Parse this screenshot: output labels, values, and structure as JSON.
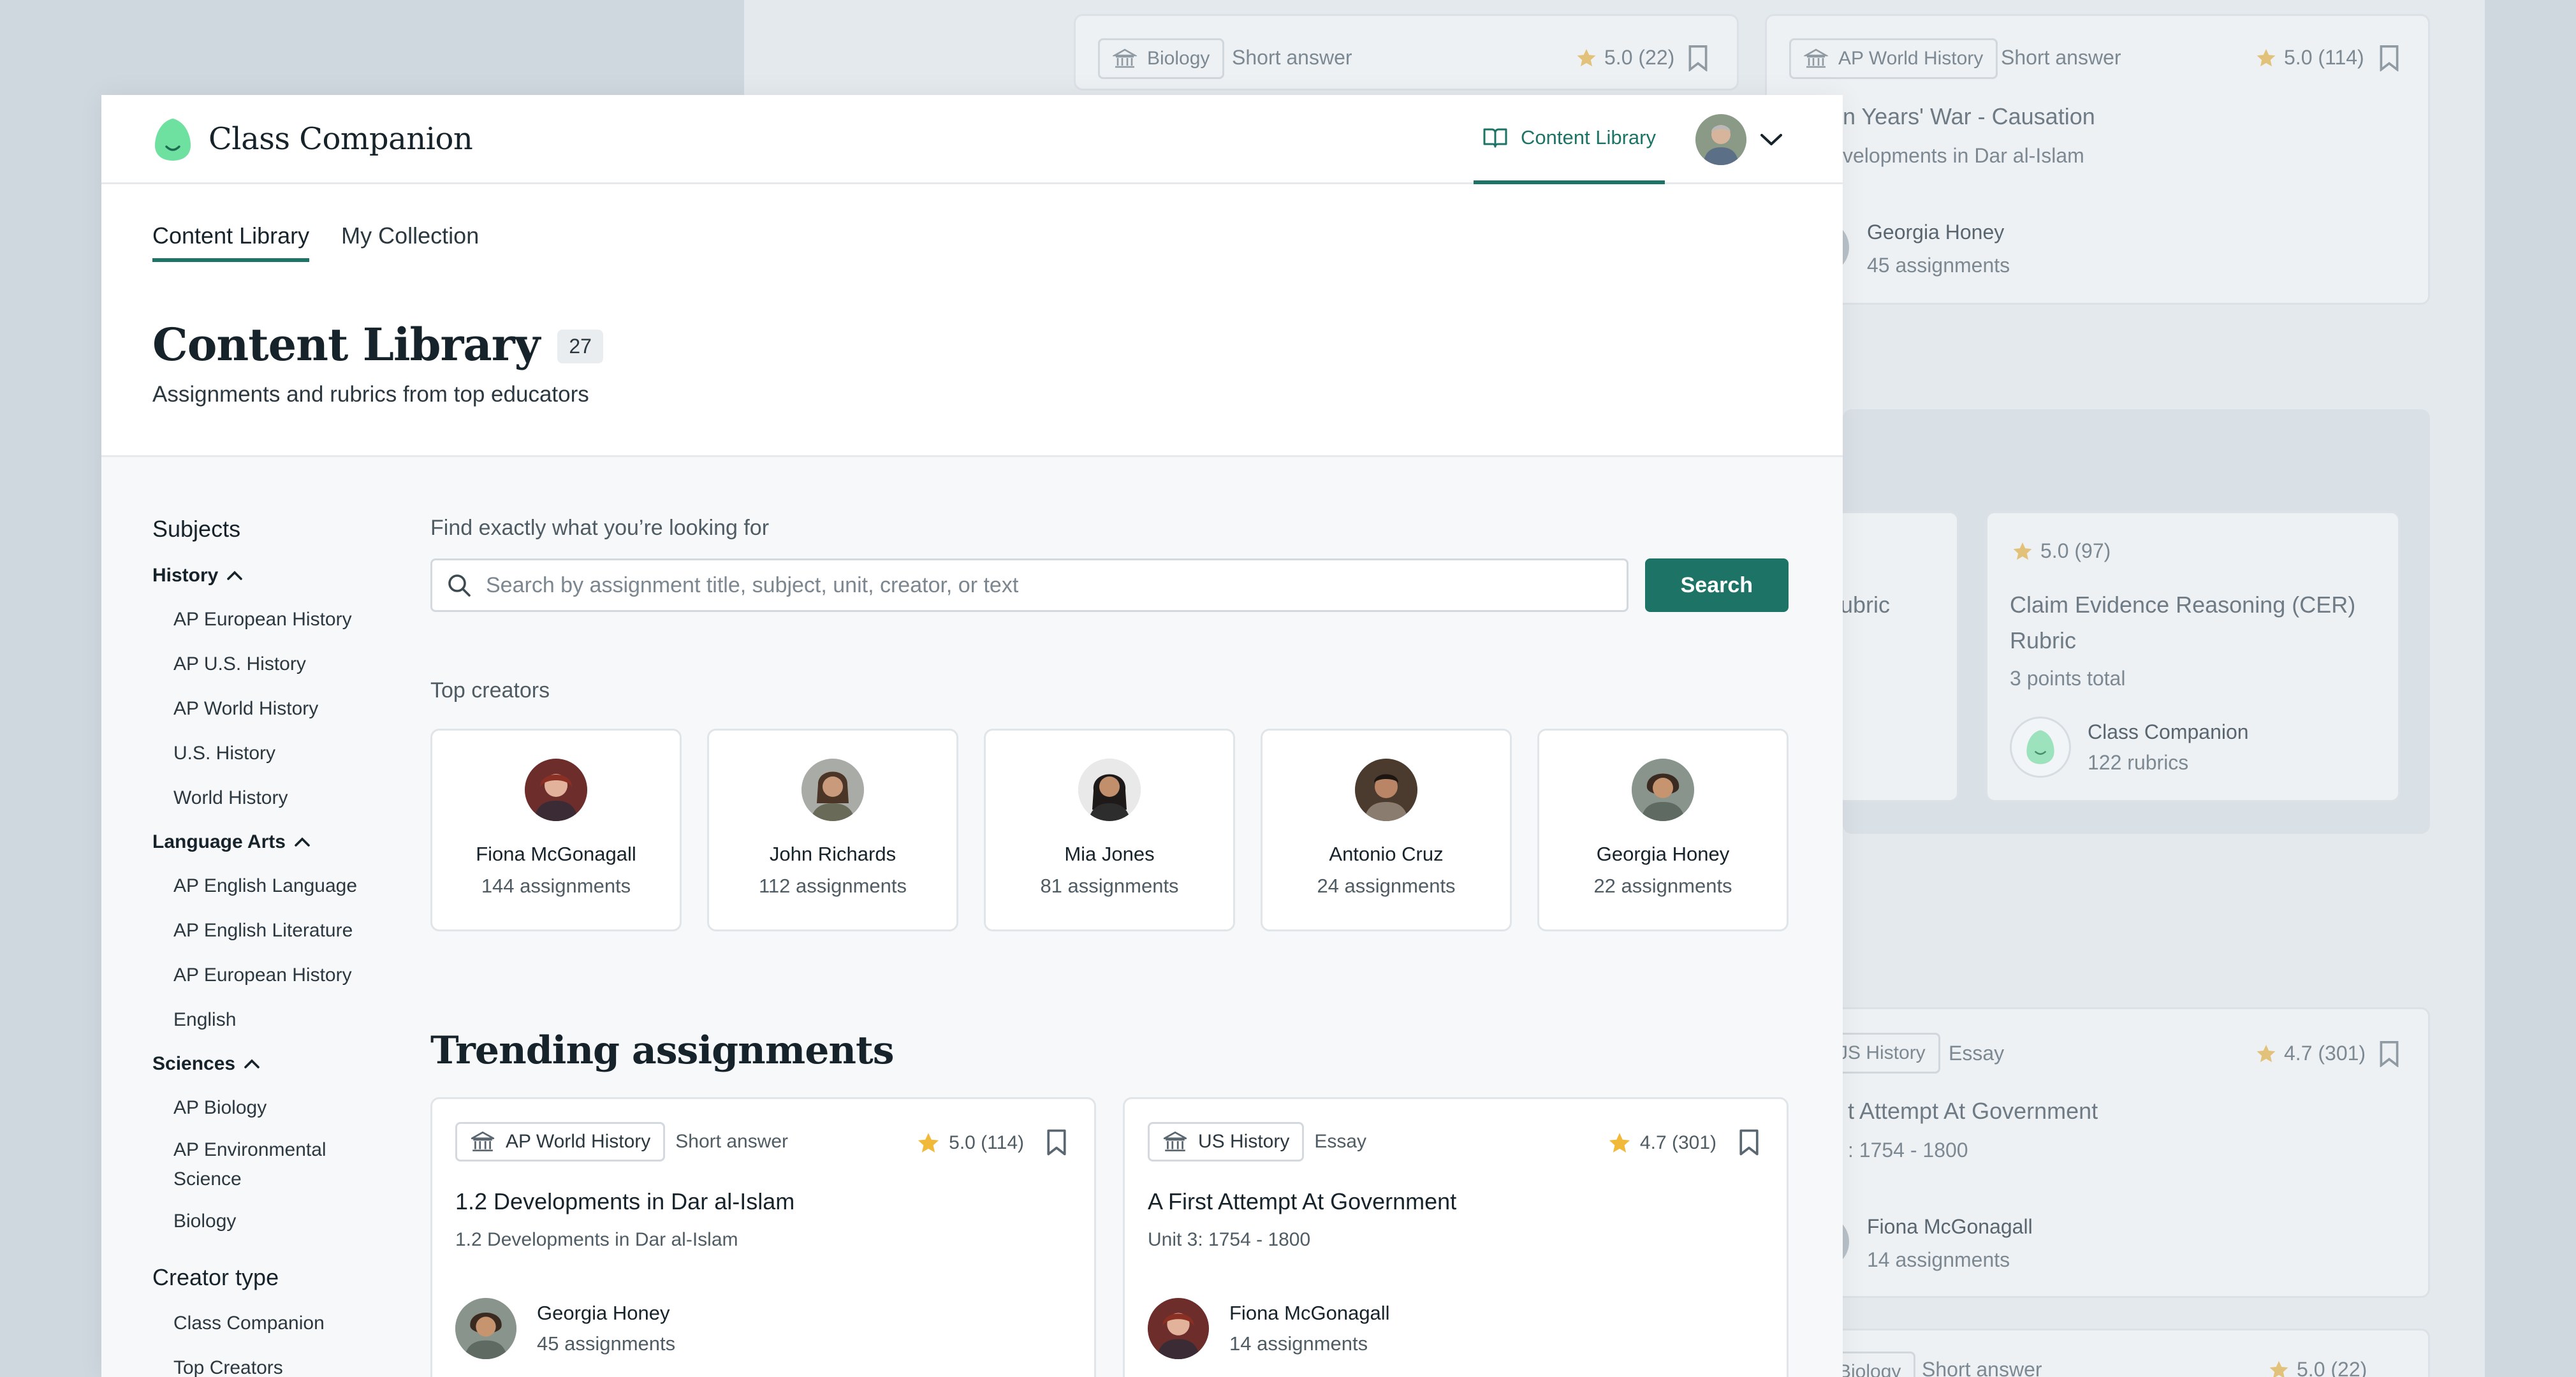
{
  "colors": {
    "accent": "#1d7466",
    "star": "#f0b93a",
    "logo": "#6ee0a0"
  },
  "background": {
    "cards": [
      {
        "subject": "Biology",
        "type": "Short answer",
        "rating": "5.0 (22)"
      },
      {
        "subject": "AP World History",
        "type": "Short answer",
        "rating": "5.0 (114)",
        "title": "n Years' War - Causation",
        "sub": "velopments in Dar al-Islam",
        "author": "Georgia Honey",
        "count": "45 assignments"
      },
      {
        "title_a": "ubric"
      },
      {
        "rating": "5.0 (97)",
        "title_line1": "Claim Evidence Reasoning (CER)",
        "title_line2": "Rubric",
        "points": "3 points total",
        "author": "Class Companion",
        "count": "122 rubrics"
      },
      {
        "subject": "JS History",
        "type": "Essay",
        "rating": "4.7 (301)",
        "title": "t Attempt At Government",
        "sub": ": 1754 - 1800",
        "author": "Fiona McGonagall",
        "count": "14 assignments"
      },
      {
        "subject": "Biology",
        "type": "Short answer",
        "rating": "5.0 (22)"
      }
    ]
  },
  "nav": {
    "brand": "Class Companion",
    "link_label": "Content Library",
    "icons": {
      "link": "book-open-icon",
      "dropdown": "chevron-down-icon"
    }
  },
  "tabs": [
    {
      "label": "Content Library",
      "active": true
    },
    {
      "label": "My Collection",
      "active": false
    }
  ],
  "header": {
    "title": "Content Library",
    "count": "27",
    "subtitle": "Assignments and rubrics from top educators"
  },
  "sidebar": {
    "subjects_heading": "Subjects",
    "groups": [
      {
        "label": "History",
        "items": [
          "AP European History",
          "AP U.S. History",
          "AP World History",
          "U.S. History",
          "World History"
        ]
      },
      {
        "label": "Language Arts",
        "items": [
          "AP English Language",
          "AP English Literature",
          "AP European History",
          "English"
        ]
      },
      {
        "label": "Sciences",
        "items": [
          "AP Biology",
          "AP Environmental Science",
          "Biology"
        ]
      }
    ],
    "creator_heading": "Creator type",
    "creator_items": [
      "Class Companion",
      "Top Creators"
    ]
  },
  "search": {
    "label": "Find exactly what you’re looking for",
    "placeholder": "Search by assignment title, subject, unit, creator, or text",
    "button": "Search"
  },
  "creators": {
    "label": "Top creators",
    "items": [
      {
        "name": "Fiona McGonagall",
        "count": "144 assignments"
      },
      {
        "name": "John Richards",
        "count": "112 assignments"
      },
      {
        "name": "Mia Jones",
        "count": "81 assignments"
      },
      {
        "name": "Antonio Cruz",
        "count": "24 assignments"
      },
      {
        "name": "Georgia Honey",
        "count": "22 assignments"
      }
    ]
  },
  "trending": {
    "title": "Trending assignments",
    "items": [
      {
        "subject": "AP World History",
        "type": "Short answer",
        "rating": "5.0 (114)",
        "title": "1.2 Developments in Dar al-Islam",
        "sub": "1.2 Developments in Dar al-Islam",
        "author": "Georgia Honey",
        "count": "45 assignments"
      },
      {
        "subject": "US History",
        "type": "Essay",
        "rating": "4.7 (301)",
        "title": "A First Attempt At Government",
        "sub": "Unit 3: 1754 - 1800",
        "author": "Fiona McGonagall",
        "count": "14 assignments"
      }
    ]
  }
}
